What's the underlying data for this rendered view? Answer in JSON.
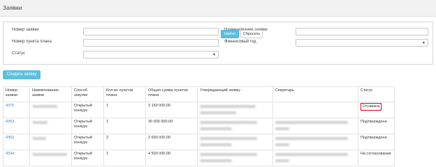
{
  "header": {
    "title": "Заявки"
  },
  "filters": {
    "request_number_label": "Номер заявки",
    "plan_item_number_label": "Номер пункта плана",
    "status_label": "Статус",
    "request_name_label": "Наименование заявки",
    "financial_year_label": "Финансовый год",
    "find_label": "Найти",
    "reset_label": "Сбросить"
  },
  "actions": {
    "create_label": "Создать заявку"
  },
  "table": {
    "headers": [
      "Номер заявки",
      "Наименование заявки",
      "Способ закупки",
      "Кол-во пунктов плана",
      "Общая сумма пунктов плана",
      "Утверждающий заявку",
      "Секретарь",
      "Статус"
    ],
    "rows": [
      {
        "number": "4375",
        "method": "Открытый конкурс",
        "items_count": "1",
        "total": "3 150 000.00",
        "status": "Отозвана"
      },
      {
        "number": "4353",
        "method": "Открытый конкурс",
        "items_count": "1",
        "total": "30 000 000.00",
        "status": "Подтверждена"
      },
      {
        "number": "4352",
        "method": "Открытый конкурс",
        "items_count": "2",
        "total": "2 600 000.00",
        "status": "Подтверждена"
      },
      {
        "number": "4334",
        "method": "Открытый конкурс",
        "items_count": "1",
        "total": "4 500 000.00",
        "status": "На согласовании"
      }
    ]
  }
}
